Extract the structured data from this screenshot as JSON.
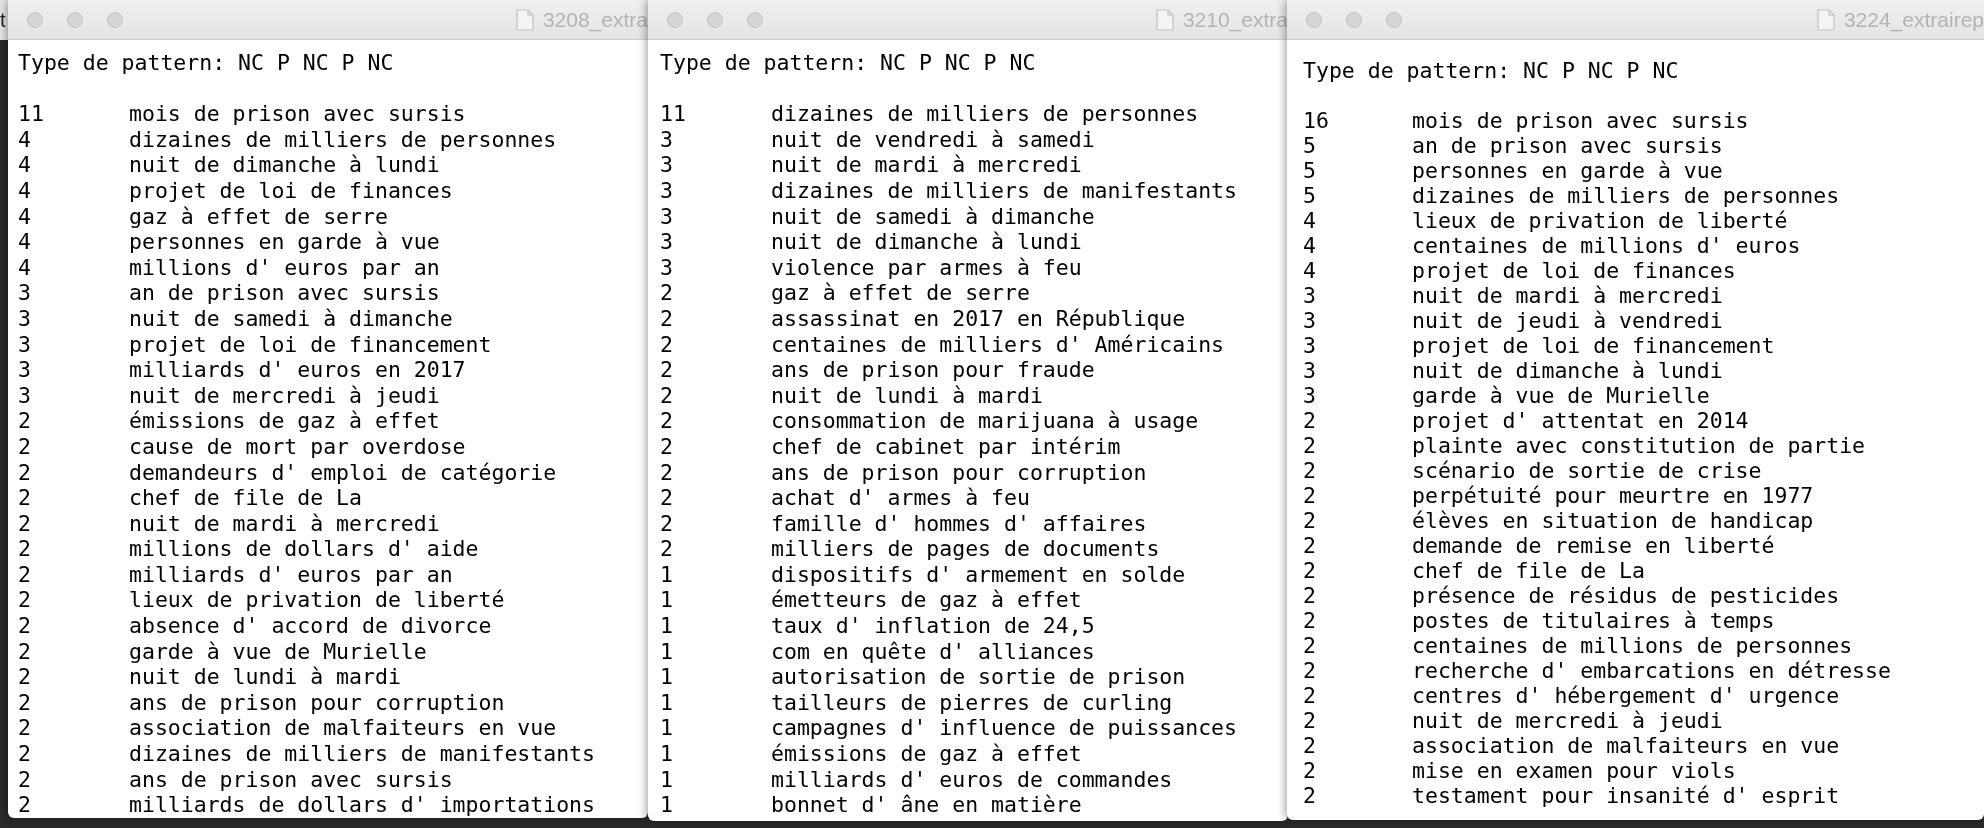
{
  "background_window": {
    "title": "t"
  },
  "windows": [
    {
      "title": "3208_extra",
      "header": "Type de pattern: NC P NC P NC",
      "rows": [
        {
          "count": "11",
          "pattern": "mois de prison avec sursis"
        },
        {
          "count": "4",
          "pattern": "dizaines de milliers de personnes"
        },
        {
          "count": "4",
          "pattern": "nuit de dimanche à lundi"
        },
        {
          "count": "4",
          "pattern": "projet de loi de finances"
        },
        {
          "count": "4",
          "pattern": "gaz à effet de serre"
        },
        {
          "count": "4",
          "pattern": "personnes en garde à vue"
        },
        {
          "count": "4",
          "pattern": "millions d' euros par an"
        },
        {
          "count": "3",
          "pattern": "an de prison avec sursis"
        },
        {
          "count": "3",
          "pattern": "nuit de samedi à dimanche"
        },
        {
          "count": "3",
          "pattern": "projet de loi de financement"
        },
        {
          "count": "3",
          "pattern": "milliards d' euros en 2017"
        },
        {
          "count": "3",
          "pattern": "nuit de mercredi à jeudi"
        },
        {
          "count": "2",
          "pattern": "émissions de gaz à effet"
        },
        {
          "count": "2",
          "pattern": "cause de mort par overdose"
        },
        {
          "count": "2",
          "pattern": "demandeurs d' emploi de catégorie"
        },
        {
          "count": "2",
          "pattern": "chef de file de La"
        },
        {
          "count": "2",
          "pattern": "nuit de mardi à mercredi"
        },
        {
          "count": "2",
          "pattern": "millions de dollars d' aide"
        },
        {
          "count": "2",
          "pattern": "milliards d' euros par an"
        },
        {
          "count": "2",
          "pattern": "lieux de privation de liberté"
        },
        {
          "count": "2",
          "pattern": "absence d' accord de divorce"
        },
        {
          "count": "2",
          "pattern": "garde à vue de Murielle"
        },
        {
          "count": "2",
          "pattern": "nuit de lundi à mardi"
        },
        {
          "count": "2",
          "pattern": "ans de prison pour corruption"
        },
        {
          "count": "2",
          "pattern": "association de malfaiteurs en vue"
        },
        {
          "count": "2",
          "pattern": "dizaines de milliers de manifestants"
        },
        {
          "count": "2",
          "pattern": "ans de prison avec sursis"
        },
        {
          "count": "2",
          "pattern": "milliards de dollars d' importations"
        }
      ]
    },
    {
      "title": "3210_extra",
      "header": "Type de pattern: NC P NC P NC",
      "rows": [
        {
          "count": "11",
          "pattern": "dizaines de milliers de personnes"
        },
        {
          "count": "3",
          "pattern": "nuit de vendredi à samedi"
        },
        {
          "count": "3",
          "pattern": "nuit de mardi à mercredi"
        },
        {
          "count": "3",
          "pattern": "dizaines de milliers de manifestants"
        },
        {
          "count": "3",
          "pattern": "nuit de samedi à dimanche"
        },
        {
          "count": "3",
          "pattern": "nuit de dimanche à lundi"
        },
        {
          "count": "3",
          "pattern": "violence par armes à feu"
        },
        {
          "count": "2",
          "pattern": "gaz à effet de serre"
        },
        {
          "count": "2",
          "pattern": "assassinat en 2017 en République"
        },
        {
          "count": "2",
          "pattern": "centaines de milliers d' Américains"
        },
        {
          "count": "2",
          "pattern": "ans de prison pour fraude"
        },
        {
          "count": "2",
          "pattern": "nuit de lundi à mardi"
        },
        {
          "count": "2",
          "pattern": "consommation de marijuana à usage"
        },
        {
          "count": "2",
          "pattern": "chef de cabinet par intérim"
        },
        {
          "count": "2",
          "pattern": "ans de prison pour corruption"
        },
        {
          "count": "2",
          "pattern": "achat d' armes à feu"
        },
        {
          "count": "2",
          "pattern": "famille d' hommes d' affaires"
        },
        {
          "count": "2",
          "pattern": "milliers de pages de documents"
        },
        {
          "count": "1",
          "pattern": "dispositifs d' armement en solde"
        },
        {
          "count": "1",
          "pattern": "émetteurs de gaz à effet"
        },
        {
          "count": "1",
          "pattern": "taux d' inflation de 24,5"
        },
        {
          "count": "1",
          "pattern": "com en quête d' alliances"
        },
        {
          "count": "1",
          "pattern": "autorisation de sortie de prison"
        },
        {
          "count": "1",
          "pattern": "tailleurs de pierres de curling"
        },
        {
          "count": "1",
          "pattern": "campagnes d' influence de puissances"
        },
        {
          "count": "1",
          "pattern": "émissions de gaz à effet"
        },
        {
          "count": "1",
          "pattern": "milliards d' euros de commandes"
        },
        {
          "count": "1",
          "pattern": "bonnet d' âne en matière"
        }
      ]
    },
    {
      "title": "3224_extrairep",
      "header": "Type de pattern: NC P NC P NC",
      "rows": [
        {
          "count": "16",
          "pattern": "mois de prison avec sursis"
        },
        {
          "count": "5",
          "pattern": "an de prison avec sursis"
        },
        {
          "count": "5",
          "pattern": "personnes en garde à vue"
        },
        {
          "count": "5",
          "pattern": "dizaines de milliers de personnes"
        },
        {
          "count": "4",
          "pattern": "lieux de privation de liberté"
        },
        {
          "count": "4",
          "pattern": "centaines de millions d' euros"
        },
        {
          "count": "4",
          "pattern": "projet de loi de finances"
        },
        {
          "count": "3",
          "pattern": "nuit de mardi à mercredi"
        },
        {
          "count": "3",
          "pattern": "nuit de jeudi à vendredi"
        },
        {
          "count": "3",
          "pattern": "projet de loi de financement"
        },
        {
          "count": "3",
          "pattern": "nuit de dimanche à lundi"
        },
        {
          "count": "3",
          "pattern": "garde à vue de Murielle"
        },
        {
          "count": "2",
          "pattern": "projet d' attentat en 2014"
        },
        {
          "count": "2",
          "pattern": "plainte avec constitution de partie"
        },
        {
          "count": "2",
          "pattern": "scénario de sortie de crise"
        },
        {
          "count": "2",
          "pattern": "perpétuité pour meurtre en 1977"
        },
        {
          "count": "2",
          "pattern": "élèves en situation de handicap"
        },
        {
          "count": "2",
          "pattern": "demande de remise en liberté"
        },
        {
          "count": "2",
          "pattern": "chef de file de La"
        },
        {
          "count": "2",
          "pattern": "présence de résidus de pesticides"
        },
        {
          "count": "2",
          "pattern": "postes de titulaires à temps"
        },
        {
          "count": "2",
          "pattern": "centaines de millions de personnes"
        },
        {
          "count": "2",
          "pattern": "recherche d' embarcations en détresse"
        },
        {
          "count": "2",
          "pattern": "centres d' hébergement d' urgence"
        },
        {
          "count": "2",
          "pattern": "nuit de mercredi à jeudi"
        },
        {
          "count": "2",
          "pattern": "association de malfaiteurs en vue"
        },
        {
          "count": "2",
          "pattern": "mise en examen pour viols"
        },
        {
          "count": "2",
          "pattern": "testament pour insanité d' esprit"
        }
      ]
    }
  ]
}
